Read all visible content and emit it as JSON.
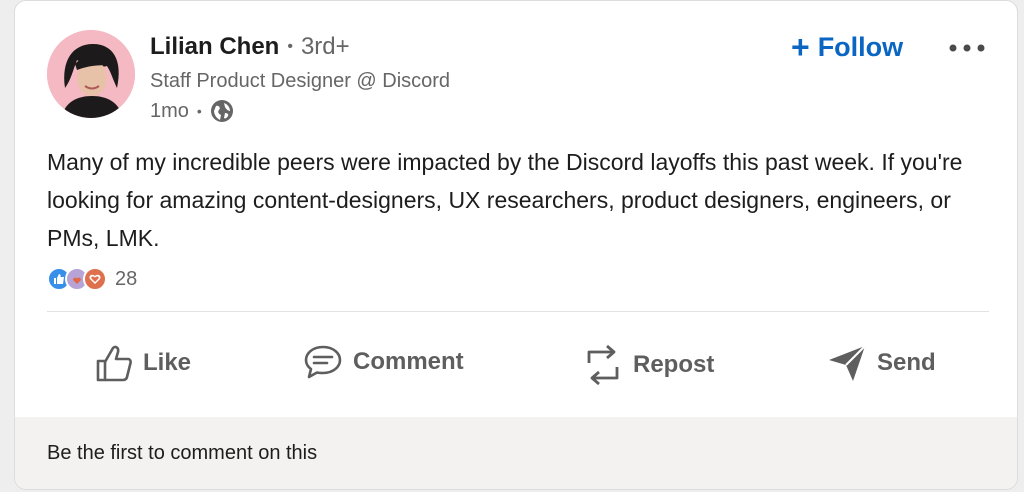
{
  "post": {
    "author": {
      "name": "Lilian Chen",
      "degree": "3rd+",
      "headline": "Staff Product Designer @ Discord",
      "time": "1mo",
      "separator": "•"
    },
    "follow_label": "Follow",
    "follow_plus": "+",
    "body": "Many of my incredible peers were impacted by the Discord layoffs this past week. If you're looking for amazing content-designers, UX researchers, product designers, engineers, or PMs, LMK.",
    "reactions": {
      "count": "28",
      "icons": [
        "like-reaction-icon",
        "support-reaction-icon",
        "love-reaction-icon"
      ]
    },
    "actions": [
      {
        "label": "Like",
        "icon": "thumbs-up-icon"
      },
      {
        "label": "Comment",
        "icon": "comment-icon"
      },
      {
        "label": "Repost",
        "icon": "repost-icon"
      },
      {
        "label": "Send",
        "icon": "send-icon"
      }
    ],
    "comment_prompt": "Be the first to comment on this"
  },
  "colors": {
    "accent": "#0a66c2",
    "text": "#1d1d1d",
    "muted": "#666666",
    "footer_bg": "#f3f2f0"
  }
}
